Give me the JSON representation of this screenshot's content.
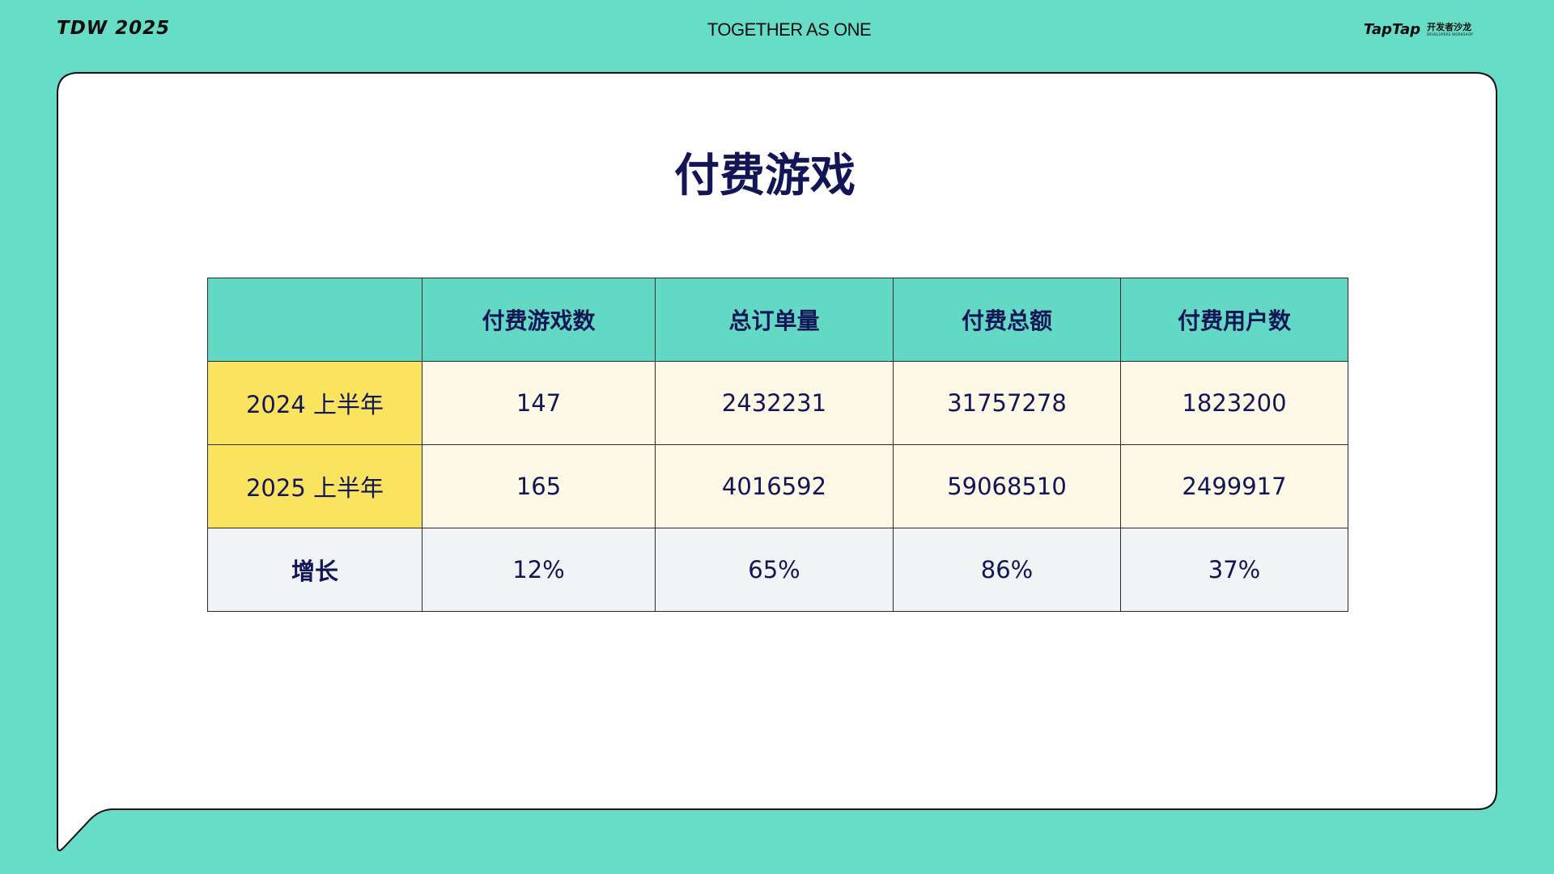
{
  "header": {
    "left_brand": "TDW 2025",
    "center_slogan": "TOGETHER AS ONE",
    "right_brand": "TapTap",
    "right_brand_cn": "开发者沙龙",
    "right_brand_en": "DEVELOPERS WORKSHOP"
  },
  "slide": {
    "title": "付费游戏"
  },
  "table": {
    "headers": [
      "",
      "付费游戏数",
      "总订单量",
      "付费总额",
      "付费用户数"
    ],
    "rows": [
      {
        "label": "2024 上半年",
        "values": [
          "147",
          "2432231",
          "31757278",
          "1823200"
        ]
      },
      {
        "label": "2025 上半年",
        "values": [
          "165",
          "4016592",
          "59068510",
          "2499917"
        ]
      },
      {
        "label": "增长",
        "values": [
          "12%",
          "65%",
          "86%",
          "37%"
        ]
      }
    ]
  },
  "colors": {
    "background": "#67dcc6",
    "header_cell": "#63d8c4",
    "year_label_cell": "#f9e35f",
    "year_value_cell": "#fdf9e6",
    "growth_cell": "#f2f3f5",
    "text": "#121656"
  }
}
